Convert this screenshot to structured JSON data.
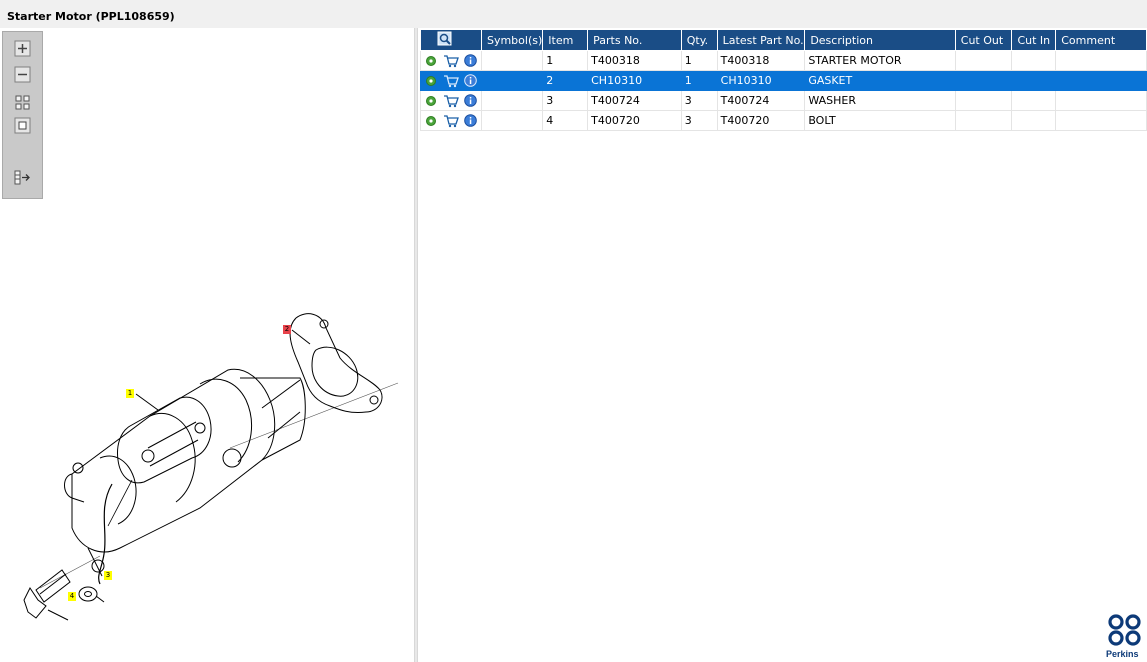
{
  "window": {
    "title": "Starter Motor (PPL108659)"
  },
  "toolbar": {
    "buttons": [
      {
        "name": "zoom-in-icon"
      },
      {
        "name": "zoom-out-icon"
      },
      {
        "name": "fit-all-icon"
      },
      {
        "name": "actual-size-icon"
      },
      {
        "name": "toggle-panel-icon"
      }
    ]
  },
  "diagram": {
    "callouts": [
      {
        "label": "1",
        "color": "#ffff00"
      },
      {
        "label": "2",
        "color": "#e8424a"
      },
      {
        "label": "3",
        "color": "#ffff00"
      },
      {
        "label": "4",
        "color": "#ffff00"
      }
    ]
  },
  "table": {
    "columns": [
      "",
      "Symbol(s)",
      "Item",
      "Parts No.",
      "Qty.",
      "Latest Part No.",
      "Description",
      "Cut Out",
      "Cut In",
      "Comment"
    ],
    "rows": [
      {
        "item": "1",
        "parts_no": "T400318",
        "qty": "1",
        "latest_part_no": "T400318",
        "description": "STARTER MOTOR",
        "symbols": "",
        "cut_out": "",
        "cut_in": "",
        "comment": ""
      },
      {
        "item": "2",
        "parts_no": "CH10310",
        "qty": "1",
        "latest_part_no": "CH10310",
        "description": "GASKET",
        "symbols": "",
        "cut_out": "",
        "cut_in": "",
        "comment": ""
      },
      {
        "item": "3",
        "parts_no": "T400724",
        "qty": "3",
        "latest_part_no": "T400724",
        "description": "WASHER",
        "symbols": "",
        "cut_out": "",
        "cut_in": "",
        "comment": ""
      },
      {
        "item": "4",
        "parts_no": "T400720",
        "qty": "3",
        "latest_part_no": "T400720",
        "description": "BOLT",
        "symbols": "",
        "cut_out": "",
        "cut_in": "",
        "comment": ""
      }
    ],
    "selected_row": 1
  },
  "colors": {
    "header_bg": "#1a4d86",
    "selected_row": "#0a74d6",
    "brand": "#0d3a78"
  },
  "brand": {
    "name": "Perkins"
  }
}
